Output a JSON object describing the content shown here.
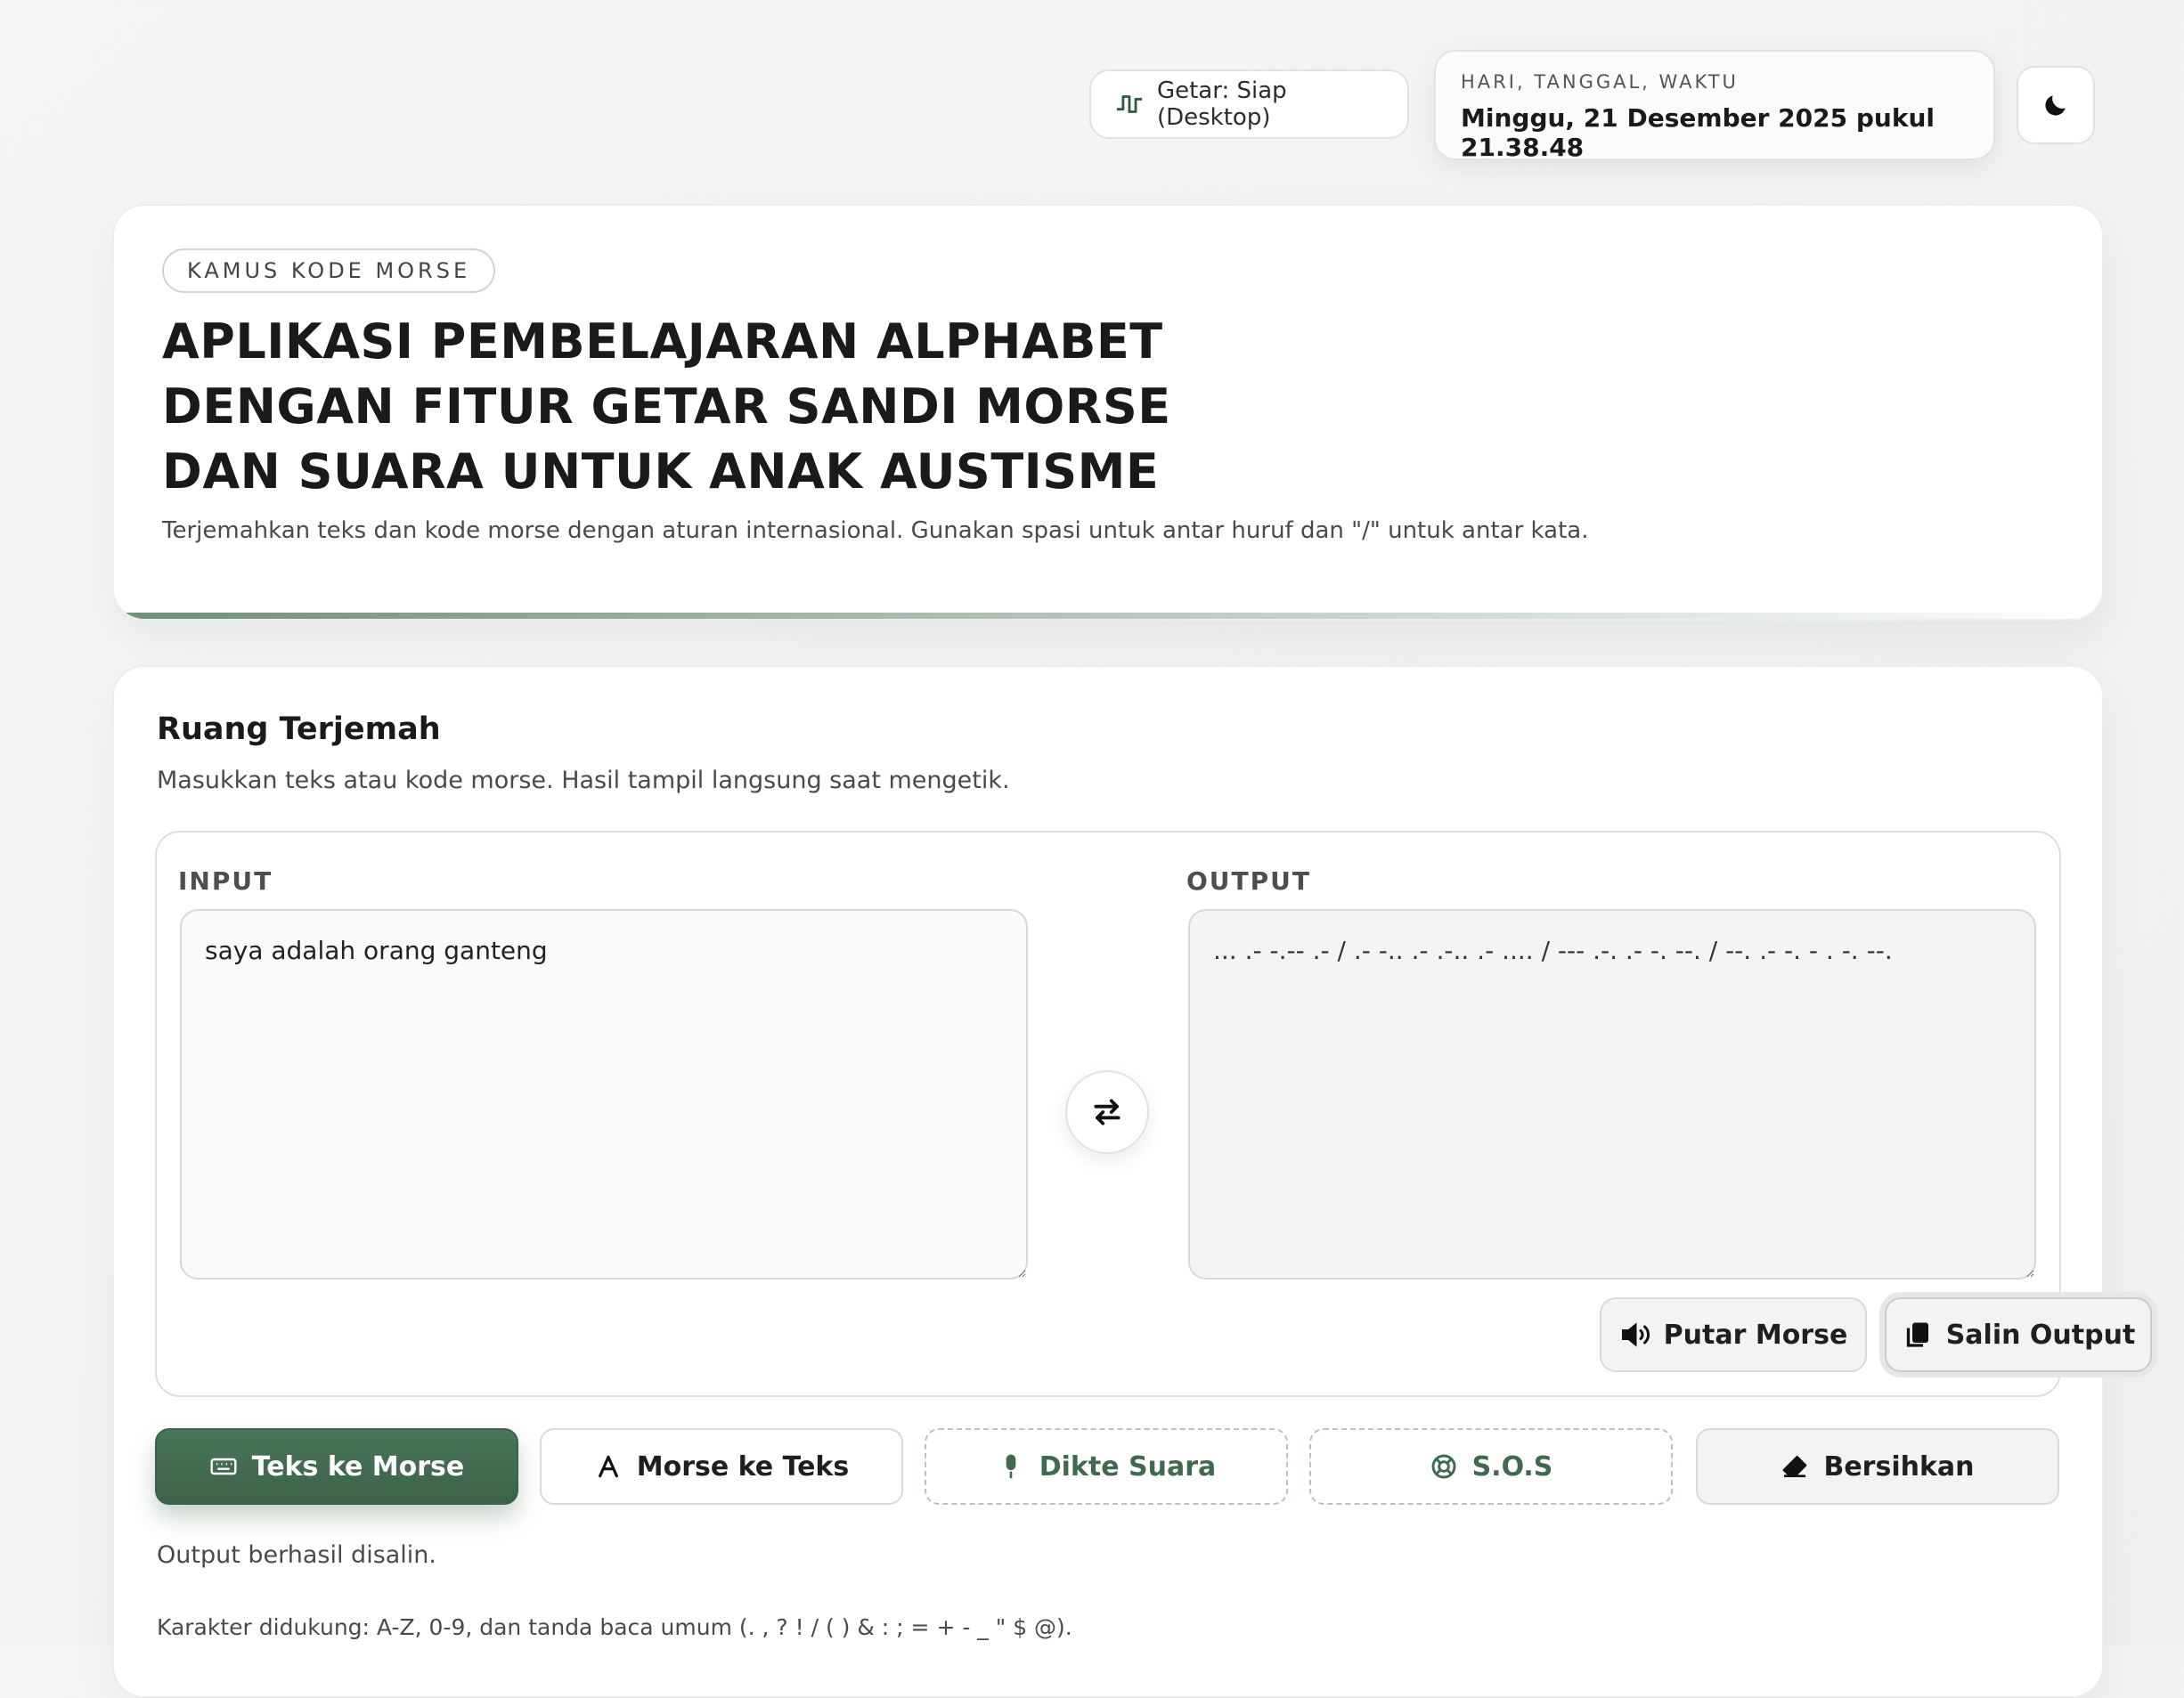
{
  "topbar": {
    "vibration_status": "Getar: Siap (Desktop)",
    "datetime_label": "HARI, TANGGAL, WAKTU",
    "datetime_value": "Minggu, 21 Desember 2025 pukul 21.38.48",
    "icons": {
      "vibration": "pulse-icon",
      "theme": "moon-icon"
    }
  },
  "hero": {
    "badge": "KAMUS KODE MORSE",
    "title_lines": [
      "APLIKASI PEMBELAJARAN ALPHABET",
      "DENGAN FITUR GETAR SANDI MORSE",
      "DAN SUARA UNTUK ANAK AUSTISME"
    ],
    "description": "Terjemahkan teks dan kode morse dengan aturan internasional. Gunakan spasi untuk antar huruf dan \"/\" untuk antar kata."
  },
  "workspace": {
    "title": "Ruang Terjemah",
    "subtitle": "Masukkan teks atau kode morse. Hasil tampil langsung saat mengetik.",
    "input_label": "INPUT",
    "output_label": "OUTPUT",
    "input_value": "saya adalah orang ganteng",
    "output_value": "... .- -.-- .- / .- -.. .- .-.. .- .... / --- .-. .- -. --. / --. .- -. - . -. --.",
    "play_button": "Putar Morse",
    "copy_button": "Salin Output",
    "modes": [
      {
        "label": "Teks ke Morse",
        "icon": "keyboard-icon"
      },
      {
        "label": "Morse ke Teks",
        "icon": "font-icon"
      },
      {
        "label": "Dikte Suara",
        "icon": "microphone-icon"
      },
      {
        "label": "S.O.S",
        "icon": "lifebuoy-icon"
      },
      {
        "label": "Bersihkan",
        "icon": "eraser-icon"
      }
    ],
    "message": "Output berhasil disalin.",
    "supported_chars": "Karakter didukung: A-Z, 0-9, dan tanda baca umum (. , ? ! / ( ) & : ; = + - _ \" $ @)."
  },
  "colors": {
    "accent": "#3b6349",
    "accent_light": "#4a7558",
    "dashed_text": "#3e6a4f",
    "background": "#f3f4f3"
  }
}
